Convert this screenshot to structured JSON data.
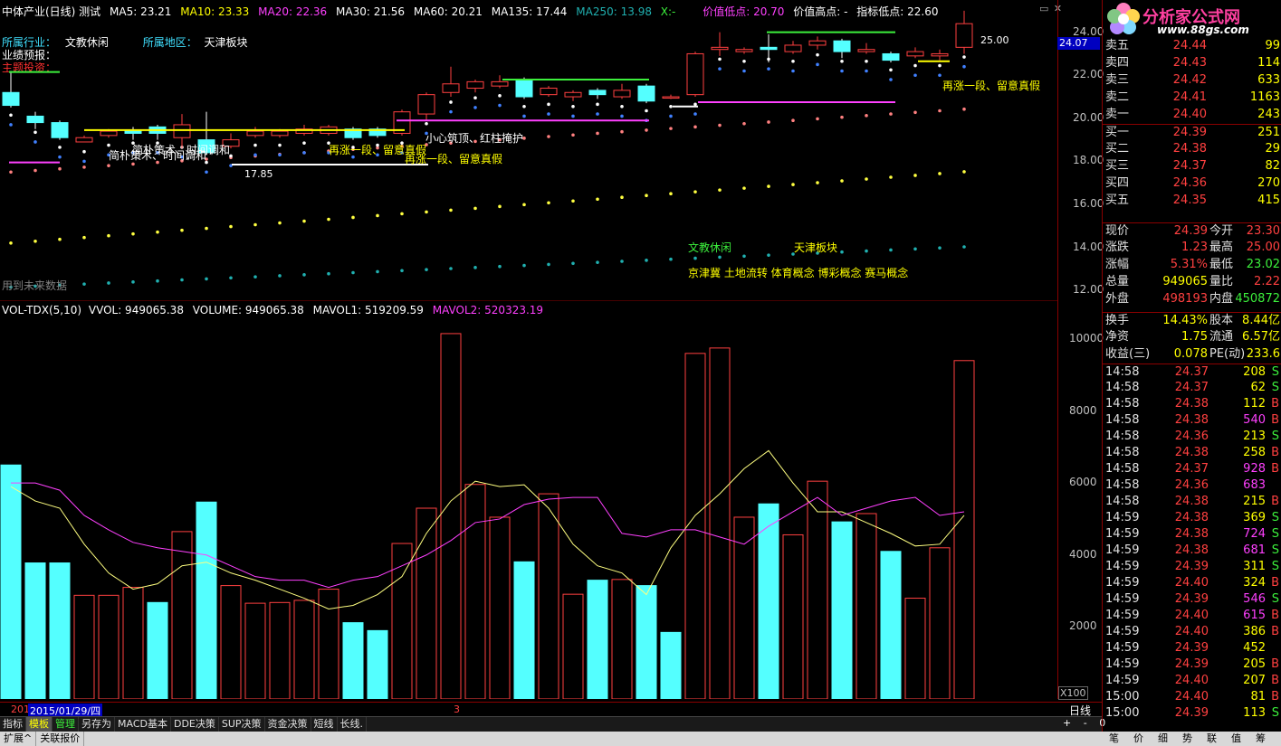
{
  "header": {
    "title": "中体产业(日线) 测试",
    "ma5": "MA5: 23.21",
    "ma10": "MA10: 23.33",
    "ma20": "MA20: 22.36",
    "ma30": "MA30: 21.56",
    "ma60": "MA60: 20.21",
    "ma135": "MA135: 17.44",
    "ma250": "MA250: 13.98",
    "x": "X:-",
    "low_value": "价值低点: 20.70",
    "high_value": "价值高点: -",
    "indicator_low": "指标低点: 22.60"
  },
  "info": {
    "industry_label": "所属行业：",
    "industry": "文教休闲",
    "region_label": "所属地区：",
    "region": "天津板块",
    "forecast": "业绩预报：",
    "theme": "主题投资："
  },
  "annotations": {
    "a1": "简朴策术、时间调和",
    "a2": "简朴策术、时间调和",
    "a3": "再涨一段、留意真假",
    "a4": "再涨一段、留意真假",
    "a5": "小心筑顶、红柱掩护",
    "a6": "再涨一段、留意真假",
    "low_mark": "17.85",
    "high_mark": "25.00",
    "industry_tag": "文教休闲",
    "region_tag": "天津板块",
    "concepts": "京津冀 土地流转 体育概念 博彩概念 赛马概念",
    "future": "用到未来数据"
  },
  "price_axis": [
    "24.00",
    "22.00",
    "20.00",
    "18.00",
    "16.00",
    "14.00",
    "12.00"
  ],
  "current_price_tag": "24.07",
  "vol_header": {
    "name": "VOL-TDX(5,10)",
    "vvol": "VVOL: 949065.38",
    "volume": "VOLUME: 949065.38",
    "mavol1": "MAVOL1: 519209.59",
    "mavol2": "MAVOL2: 520323.19"
  },
  "vol_axis": [
    "10000",
    "8000",
    "6000",
    "4000",
    "2000"
  ],
  "vol_unit": "X100",
  "date_bar": {
    "left": "201",
    "date": "2015/01/29/四",
    "mark": "3"
  },
  "toolbar": [
    "指标",
    "模板",
    "管理",
    "另存为",
    "MACD基本",
    "DDE决策",
    "SUP决策",
    "资金决策",
    "短线",
    "长线."
  ],
  "toolbar2": [
    "扩展^",
    "关联报价"
  ],
  "right_mini": [
    "+",
    "-",
    "0"
  ],
  "period": "日线",
  "logo": {
    "text": "分析家公式网",
    "url": "www.88gs.com"
  },
  "order_book": [
    {
      "label": "卖五",
      "price": "24.44",
      "vol": "99",
      "side": "sell"
    },
    {
      "label": "卖四",
      "price": "24.43",
      "vol": "114",
      "side": "sell"
    },
    {
      "label": "卖三",
      "price": "24.42",
      "vol": "633",
      "side": "sell"
    },
    {
      "label": "卖二",
      "price": "24.41",
      "vol": "1163",
      "side": "sell"
    },
    {
      "label": "卖一",
      "price": "24.40",
      "vol": "243",
      "side": "sell"
    },
    {
      "label": "买一",
      "price": "24.39",
      "vol": "251",
      "side": "buy"
    },
    {
      "label": "买二",
      "price": "24.38",
      "vol": "29",
      "side": "buy"
    },
    {
      "label": "买三",
      "price": "24.37",
      "vol": "82",
      "side": "buy"
    },
    {
      "label": "买四",
      "price": "24.36",
      "vol": "270",
      "side": "buy"
    },
    {
      "label": "买五",
      "price": "24.35",
      "vol": "415",
      "side": "buy"
    }
  ],
  "stats": [
    {
      "l1": "现价",
      "v1": "24.39",
      "c1": "#ff4040",
      "l2": "今开",
      "v2": "23.30",
      "c2": "#ff4040"
    },
    {
      "l1": "涨跌",
      "v1": "1.23",
      "c1": "#ff4040",
      "l2": "最高",
      "v2": "25.00",
      "c2": "#ff4040"
    },
    {
      "l1": "涨幅",
      "v1": "5.31%",
      "c1": "#ff4040",
      "l2": "最低",
      "v2": "23.02",
      "c2": "#3cf03c"
    },
    {
      "l1": "总量",
      "v1": "949065",
      "c1": "#ffff00",
      "l2": "量比",
      "v2": "2.22",
      "c2": "#ff4040"
    },
    {
      "l1": "外盘",
      "v1": "498193",
      "c1": "#ff4040",
      "l2": "内盘",
      "v2": "450872",
      "c2": "#3cf03c"
    },
    {
      "l1": "换手",
      "v1": "14.43%",
      "c1": "#ffff00",
      "l2": "股本",
      "v2": "8.44亿",
      "c2": "#ffff00"
    },
    {
      "l1": "净资",
      "v1": "1.75",
      "c1": "#ffff00",
      "l2": "流通",
      "v2": "6.57亿",
      "c2": "#ffff00"
    },
    {
      "l1": "收益(三)",
      "v1": "0.078",
      "c1": "#ffff00",
      "l2": "PE(动)",
      "v2": "233.6",
      "c2": "#ffff00"
    }
  ],
  "trades": [
    {
      "t": "14:58",
      "p": "24.37",
      "v": "208",
      "s": "S"
    },
    {
      "t": "14:58",
      "p": "24.37",
      "v": "62",
      "s": "S"
    },
    {
      "t": "14:58",
      "p": "24.38",
      "v": "112",
      "s": "B"
    },
    {
      "t": "14:58",
      "p": "24.38",
      "v": "540",
      "s": "B"
    },
    {
      "t": "14:58",
      "p": "24.36",
      "v": "213",
      "s": "S"
    },
    {
      "t": "14:58",
      "p": "24.38",
      "v": "258",
      "s": "B"
    },
    {
      "t": "14:58",
      "p": "24.37",
      "v": "928",
      "s": "B"
    },
    {
      "t": "14:58",
      "p": "24.36",
      "v": "683",
      "s": ""
    },
    {
      "t": "14:58",
      "p": "24.38",
      "v": "215",
      "s": "B"
    },
    {
      "t": "14:59",
      "p": "24.38",
      "v": "369",
      "s": "S"
    },
    {
      "t": "14:59",
      "p": "24.38",
      "v": "724",
      "s": "S"
    },
    {
      "t": "14:59",
      "p": "24.38",
      "v": "681",
      "s": "S"
    },
    {
      "t": "14:59",
      "p": "24.39",
      "v": "311",
      "s": "S"
    },
    {
      "t": "14:59",
      "p": "24.40",
      "v": "324",
      "s": "B"
    },
    {
      "t": "14:59",
      "p": "24.39",
      "v": "546",
      "s": "S"
    },
    {
      "t": "14:59",
      "p": "24.40",
      "v": "615",
      "s": "B"
    },
    {
      "t": "14:59",
      "p": "24.40",
      "v": "386",
      "s": "B"
    },
    {
      "t": "14:59",
      "p": "24.39",
      "v": "452",
      "s": ""
    },
    {
      "t": "14:59",
      "p": "24.39",
      "v": "205",
      "s": "B"
    },
    {
      "t": "14:59",
      "p": "24.40",
      "v": "207",
      "s": "B"
    },
    {
      "t": "15:00",
      "p": "24.40",
      "v": "81",
      "s": "B"
    },
    {
      "t": "15:00",
      "p": "24.39",
      "v": "113",
      "s": "S"
    }
  ],
  "right_tabs": [
    "笔",
    "价",
    "细",
    "势",
    "联",
    "值",
    "筹"
  ],
  "chart_data": {
    "type": "bar",
    "candles": [
      {
        "o": 21.2,
        "c": 20.6,
        "h": 22.2,
        "l": 20.5
      },
      {
        "o": 20.1,
        "c": 19.8,
        "h": 20.3,
        "l": 19.5
      },
      {
        "o": 19.8,
        "c": 19.1,
        "h": 19.9,
        "l": 19.0
      },
      {
        "o": 18.9,
        "c": 19.1,
        "h": 19.2,
        "l": 18.9
      },
      {
        "o": 19.2,
        "c": 19.4,
        "h": 19.5,
        "l": 19.1
      },
      {
        "o": 19.4,
        "c": 19.3,
        "h": 19.6,
        "l": 19.0
      },
      {
        "o": 19.6,
        "c": 19.3,
        "h": 19.7,
        "l": 19.0
      },
      {
        "o": 19.1,
        "c": 19.7,
        "h": 20.2,
        "l": 18.6
      },
      {
        "o": 19.0,
        "c": 18.4,
        "h": 20.3,
        "l": 18.3
      },
      {
        "o": 18.7,
        "c": 19.0,
        "h": 19.3,
        "l": 18.6
      },
      {
        "o": 19.2,
        "c": 19.4,
        "h": 19.6,
        "l": 19.1
      },
      {
        "o": 19.2,
        "c": 19.4,
        "h": 19.5,
        "l": 19.1
      },
      {
        "o": 19.3,
        "c": 19.5,
        "h": 19.7,
        "l": 19.2
      },
      {
        "o": 19.3,
        "c": 19.6,
        "h": 19.7,
        "l": 19.2
      },
      {
        "o": 19.5,
        "c": 19.1,
        "h": 19.6,
        "l": 19.0
      },
      {
        "o": 19.5,
        "c": 19.2,
        "h": 19.6,
        "l": 19.1
      },
      {
        "o": 19.3,
        "c": 20.3,
        "h": 20.4,
        "l": 19.2
      },
      {
        "o": 20.2,
        "c": 21.1,
        "h": 21.2,
        "l": 19.9
      },
      {
        "o": 21.2,
        "c": 21.6,
        "h": 22.4,
        "l": 21.0
      },
      {
        "o": 21.4,
        "c": 21.7,
        "h": 21.8,
        "l": 21.2
      },
      {
        "o": 21.5,
        "c": 21.7,
        "h": 22.0,
        "l": 21.4
      },
      {
        "o": 21.8,
        "c": 21.0,
        "h": 21.9,
        "l": 20.9
      },
      {
        "o": 21.1,
        "c": 21.4,
        "h": 21.5,
        "l": 21.0
      },
      {
        "o": 21.0,
        "c": 21.2,
        "h": 21.3,
        "l": 20.8
      },
      {
        "o": 21.3,
        "c": 21.1,
        "h": 21.4,
        "l": 20.9
      },
      {
        "o": 21.0,
        "c": 21.3,
        "h": 21.6,
        "l": 20.9
      },
      {
        "o": 21.5,
        "c": 20.8,
        "h": 21.6,
        "l": 20.7
      },
      {
        "o": 21.0,
        "c": 21.0,
        "h": 21.1,
        "l": 20.9
      },
      {
        "o": 21.1,
        "c": 23.0,
        "h": 23.1,
        "l": 21.0
      },
      {
        "o": 23.2,
        "c": 23.3,
        "h": 24.0,
        "l": 22.9
      },
      {
        "o": 23.1,
        "c": 23.2,
        "h": 23.3,
        "l": 23.0
      },
      {
        "o": 23.3,
        "c": 23.2,
        "h": 23.9,
        "l": 22.6
      },
      {
        "o": 23.1,
        "c": 23.4,
        "h": 23.6,
        "l": 23.0
      },
      {
        "o": 23.4,
        "c": 23.6,
        "h": 23.8,
        "l": 23.2
      },
      {
        "o": 23.6,
        "c": 23.1,
        "h": 23.7,
        "l": 22.8
      },
      {
        "o": 23.1,
        "c": 23.2,
        "h": 23.5,
        "l": 23.0
      },
      {
        "o": 23.0,
        "c": 22.7,
        "h": 23.1,
        "l": 22.6
      },
      {
        "o": 22.9,
        "c": 23.1,
        "h": 23.3,
        "l": 22.8
      },
      {
        "o": 22.9,
        "c": 23.0,
        "h": 23.2,
        "l": 22.7
      },
      {
        "o": 23.3,
        "c": 24.4,
        "h": 25.0,
        "l": 23.0
      }
    ],
    "volume": [
      6500,
      3780,
      3780,
      2880,
      2880,
      3100,
      2680,
      4650,
      5470,
      3150,
      2660,
      2680,
      2740,
      3050,
      2120,
      1900,
      4320,
      5300,
      10150,
      5960,
      5050,
      3810,
      5700,
      2910,
      3300,
      3320,
      3150,
      1850,
      9600,
      9750,
      5050,
      5420,
      4560,
      6050,
      4920,
      5150,
      4100,
      2800,
      4200,
      9400
    ],
    "vol_up": [
      false,
      false,
      false,
      true,
      true,
      true,
      false,
      true,
      false,
      true,
      true,
      true,
      true,
      true,
      false,
      false,
      true,
      true,
      true,
      true,
      true,
      false,
      true,
      true,
      false,
      true,
      false,
      false,
      true,
      true,
      true,
      false,
      true,
      true,
      false,
      true,
      false,
      true,
      true,
      true
    ],
    "mavol1": [
      5900,
      5500,
      5300,
      4300,
      3500,
      3050,
      3200,
      3700,
      3800,
      3500,
      3300,
      3050,
      2800,
      2500,
      2600,
      2900,
      3400,
      4600,
      5500,
      6050,
      5900,
      5950,
      5300,
      4300,
      3700,
      3500,
      2900,
      4200,
      5100,
      5700,
      6400,
      6900,
      6000,
      5200,
      5200,
      4900,
      4600,
      4250,
      4300,
      5100
    ],
    "mavol2": [
      6000,
      6000,
      5800,
      5100,
      4700,
      4350,
      4200,
      4100,
      4000,
      3700,
      3400,
      3300,
      3300,
      3100,
      3300,
      3400,
      3700,
      4000,
      4400,
      4900,
      5000,
      5400,
      5550,
      5600,
      5600,
      4600,
      4500,
      4700,
      4700,
      4500,
      4300,
      4800,
      5200,
      5600,
      5100,
      5300,
      5500,
      5600,
      5100,
      5200
    ],
    "ylim_price": [
      11.5,
      25.5
    ],
    "ylim_vol": [
      0,
      10500
    ]
  }
}
